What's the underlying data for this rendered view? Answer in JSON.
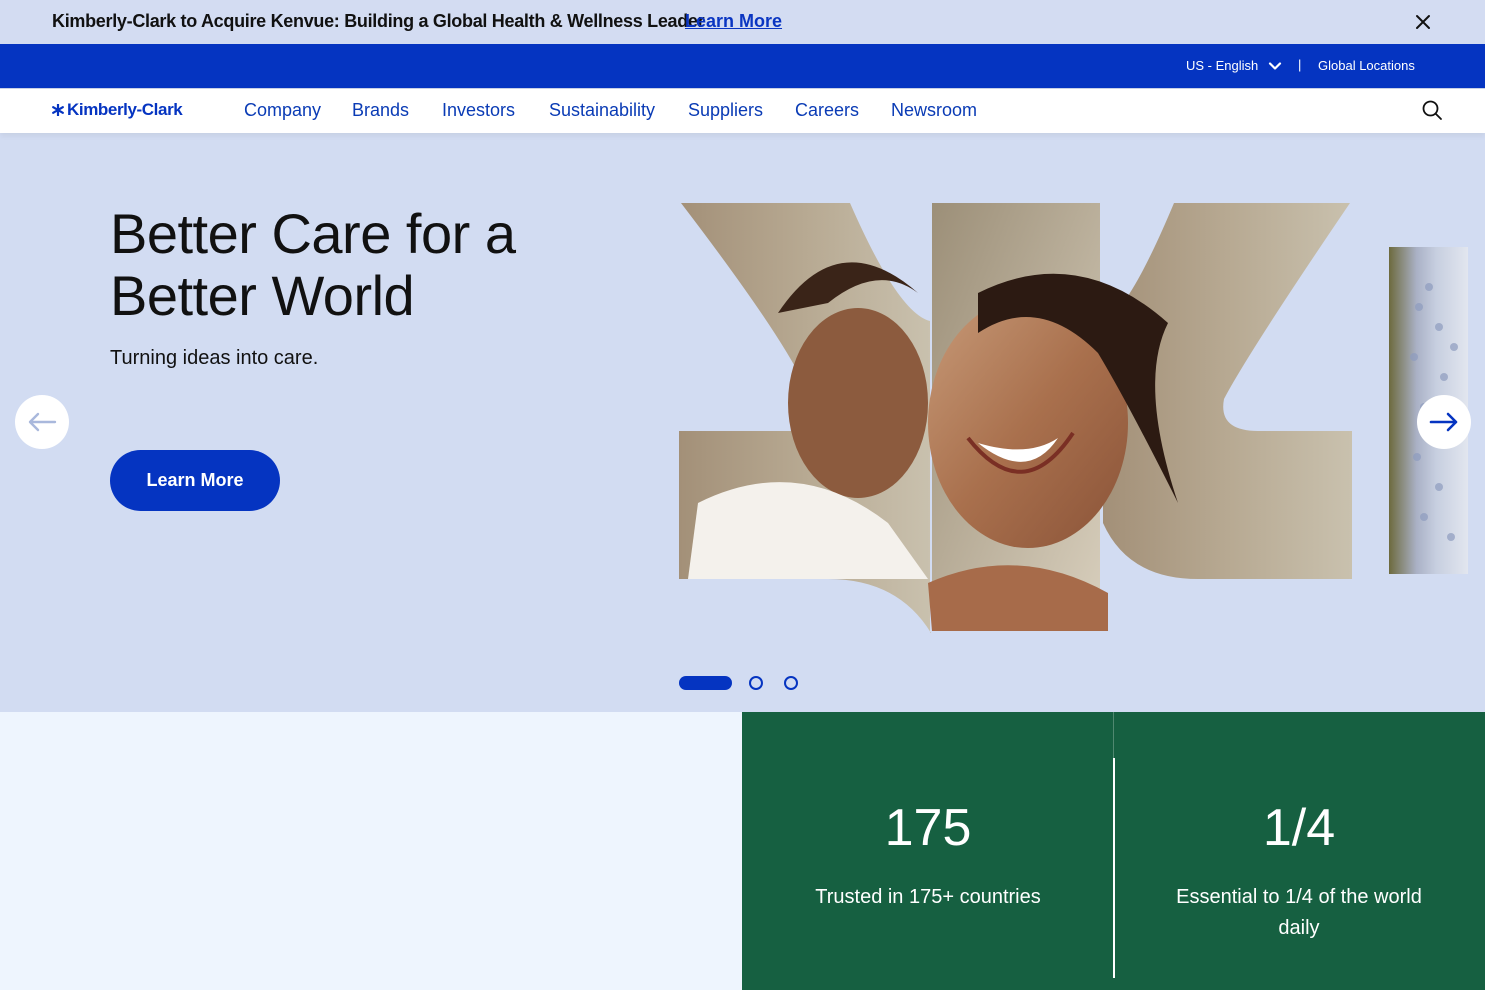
{
  "announcement": {
    "text": "Kimberly-Clark to Acquire Kenvue: Building a Global Health & Wellness Leader",
    "link_label": "Learn More",
    "close_icon": "close-icon"
  },
  "utility_bar": {
    "language": "US - English",
    "separator": "|",
    "global_locations": "Global Locations"
  },
  "nav": {
    "logo_text": "Kimberly-Clark",
    "items": [
      "Company",
      "Brands",
      "Investors",
      "Sustainability",
      "Suppliers",
      "Careers",
      "Newsroom"
    ],
    "search_icon": "search-icon"
  },
  "hero": {
    "title": "Better Care for a Better World",
    "subtitle": "Turning ideas into care.",
    "cta_label": "Learn More",
    "prev_icon": "arrow-left-icon",
    "next_icon": "arrow-right-icon",
    "slide_count": 3,
    "active_slide": 1
  },
  "stats": [
    {
      "value": "175",
      "label": "Trusted in 175+ countries"
    },
    {
      "value": "1/4",
      "label": "Essential to 1/4 of the world daily"
    }
  ],
  "colors": {
    "brand_blue": "#0534c1",
    "hero_bg": "#d2dcf2",
    "announce_bg": "#d3dcf2",
    "stats_green": "#166041",
    "page_bg": "#eef5fe"
  }
}
